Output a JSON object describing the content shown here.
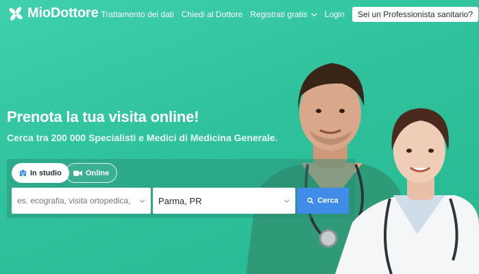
{
  "brand": {
    "name": "MioDottore",
    "accent": "#2fc29c",
    "button_color": "#3f8de9"
  },
  "nav": {
    "items": [
      {
        "label": "Trattamento dei dati"
      },
      {
        "label": "Chiedi al Dottore"
      },
      {
        "label": "Registrati gratis",
        "icon": "chevron-down-icon"
      },
      {
        "label": "Login"
      }
    ],
    "pro_button": "Sei un Professionista sanitario?"
  },
  "hero": {
    "title": "Prenota la tua visita online!",
    "subtitle": "Cerca tra 200 000 Specialisti e Medici di Medicina Generale."
  },
  "search": {
    "tabs": [
      {
        "label": "In studio",
        "icon": "hospital-icon",
        "selected": true
      },
      {
        "label": "Online",
        "icon": "video-camera-icon",
        "selected": false
      }
    ],
    "specialty_placeholder": "es. ecografia, visita ortopedica, TAC",
    "location_value": "Parma, PR",
    "submit_label": "Cerca",
    "submit_icon": "search-icon"
  }
}
